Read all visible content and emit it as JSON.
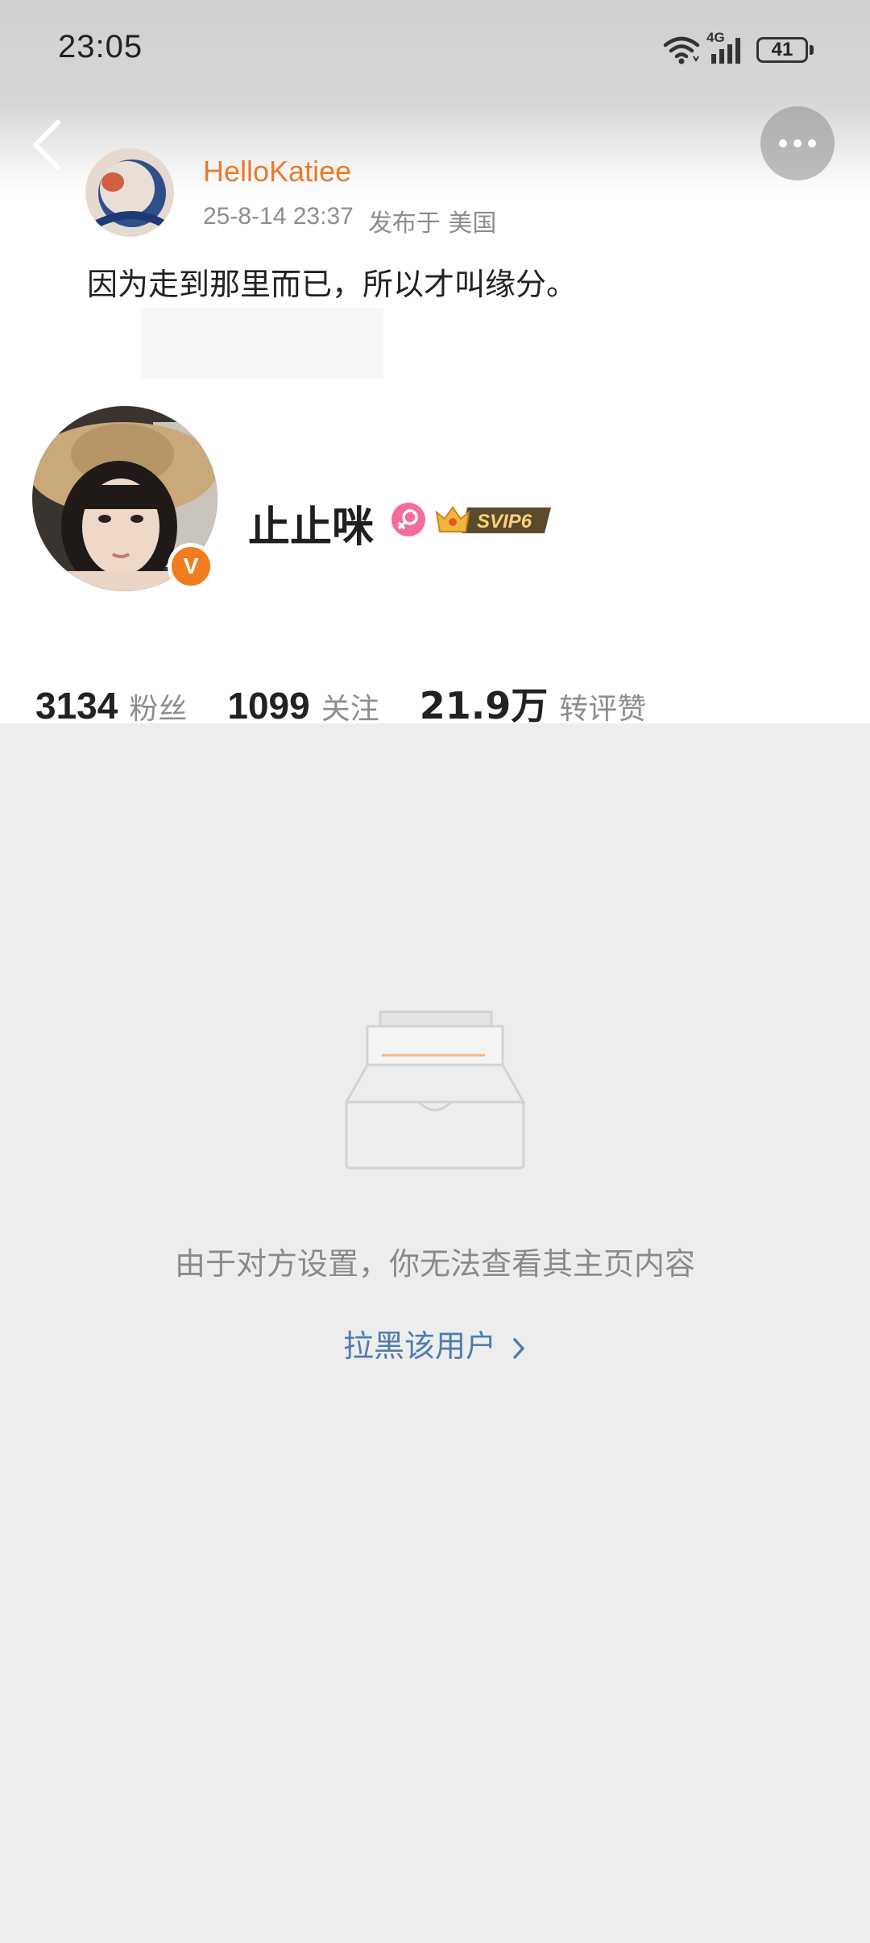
{
  "status_bar": {
    "time": "23:05",
    "network": "4G",
    "battery": "41",
    "icons": [
      "wifi-icon",
      "signal-icon",
      "battery-icon"
    ]
  },
  "nav": {
    "back_icon": "chevron-left-icon",
    "more_icon": "more-dots-icon"
  },
  "post": {
    "username": "HelloKatiee",
    "time": "25-8-14 23:37",
    "location": "发布于 美国",
    "text": "因为走到那里而已，所以才叫缘分。"
  },
  "profile": {
    "name": "止止咪",
    "gender_icon": "female-icon",
    "vip_badge": "SVIP6",
    "verified_badge": "V",
    "stats": [
      {
        "value": "3134",
        "label": "粉丝"
      },
      {
        "value": "1099",
        "label": "关注"
      },
      {
        "value": "21.9万",
        "label": "转评赞"
      }
    ]
  },
  "empty_state": {
    "illustration": "empty-inbox-icon",
    "message": "由于对方设置，你无法查看其主页内容",
    "action_label": "拉黑该用户"
  },
  "colors": {
    "accent_orange": "#e97a2c",
    "link_blue": "#4f7cb0",
    "background_gray": "#ededed",
    "female_pink": "#f36d9a"
  }
}
